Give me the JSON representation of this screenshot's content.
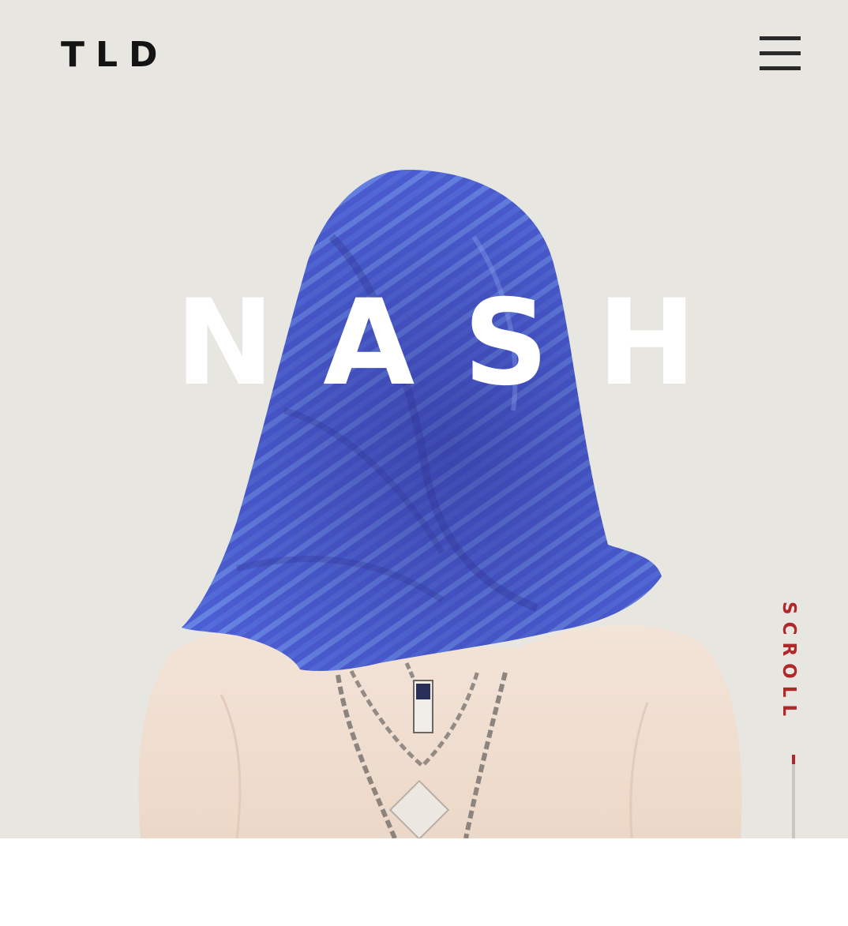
{
  "header": {
    "logo": "TLD",
    "menu_icon": "hamburger-icon"
  },
  "hero": {
    "title_letters": [
      "N",
      "A",
      "S",
      "H"
    ],
    "image": "person-with-blue-scarf-over-head",
    "scroll_label": "SCROLL",
    "scroll_progress": 0.1
  },
  "colors": {
    "background": "#e8e6e1",
    "scarf": "#4a5bd0",
    "title": "#ffffff",
    "accent": "#b0282a",
    "text": "#141414"
  }
}
